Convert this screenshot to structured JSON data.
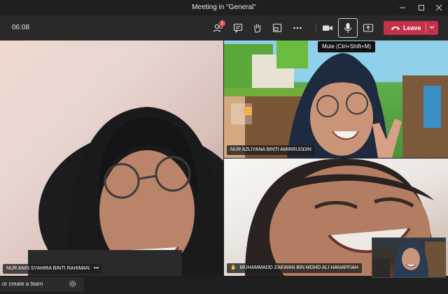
{
  "window": {
    "title": "Meeting in \"General\""
  },
  "toolbar": {
    "timer": "06:08",
    "participants_badge": "1",
    "leave_label": "Leave",
    "tooltip": "Mute (Ctrl+Shift+M)"
  },
  "participants": [
    {
      "name": "NUR ANIS SYAHIRA BINTI RAHIMAN",
      "more": "•••"
    },
    {
      "name": "NUR AZLIYANA BINTI AMIRRUDDIN"
    },
    {
      "name": "MUHAMMADD ZAKWAN BIN MOHD ALI HANAFFIAH",
      "hand": "✋"
    }
  ],
  "sidebar": {
    "create_team": "or create a team"
  },
  "colors": {
    "leave": "#c4314b",
    "badge": "#e5484d",
    "toolbar": "#292929"
  }
}
